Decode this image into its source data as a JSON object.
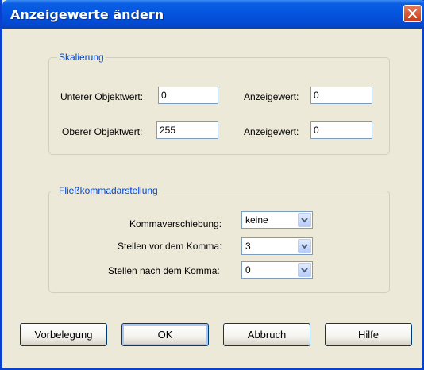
{
  "window": {
    "title": "Anzeigewerte ändern"
  },
  "scaling": {
    "legend": "Skalierung",
    "lower_label": "Unterer Objektwert:",
    "lower_value": "0",
    "lower_display_label": "Anzeigewert:",
    "lower_display_value": "0",
    "upper_label": "Oberer Objektwert:",
    "upper_value": "255",
    "upper_display_label": "Anzeigewert:",
    "upper_display_value": "0"
  },
  "float": {
    "legend": "Fließkommadarstellung",
    "shift_label": "Kommaverschiebung:",
    "shift_value": "keine",
    "before_label": "Stellen vor dem Komma:",
    "before_value": "3",
    "after_label": "Stellen nach dem Komma:",
    "after_value": "0"
  },
  "buttons": {
    "defaults": "Vorbelegung",
    "ok": "OK",
    "cancel": "Abbruch",
    "help": "Hilfe"
  }
}
